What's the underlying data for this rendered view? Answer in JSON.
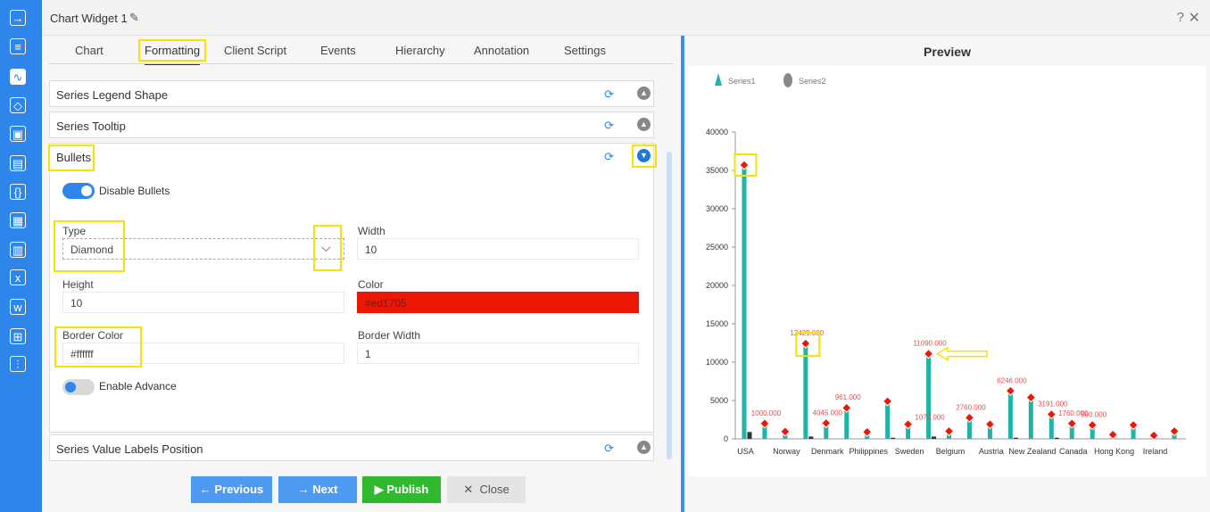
{
  "window": {
    "title": "Chart Widget 1",
    "help": "?",
    "close": "✕"
  },
  "rail": {
    "icons": [
      "sign-in-icon",
      "table-icon",
      "chart-icon",
      "cubes-icon",
      "doc-icon",
      "id-card-icon",
      "braces-icon",
      "image-icon",
      "layout-icon",
      "excel-icon",
      "word-icon",
      "hierarchy-icon",
      "stats-icon"
    ]
  },
  "tabs": [
    "Chart",
    "Formatting",
    "Client Script",
    "Events",
    "Hierarchy",
    "Annotation",
    "Settings"
  ],
  "sections": {
    "legend_shape": "Series Legend Shape",
    "tooltip": "Series Tooltip",
    "bullets": "Bullets",
    "value_labels": "Series Value Labels Position"
  },
  "bullets": {
    "disable_label": "Disable Bullets",
    "type_label": "Type",
    "type_value": "Diamond",
    "width_label": "Width",
    "width_value": "10",
    "height_label": "Height",
    "height_value": "10",
    "color_label": "Color",
    "color_value": "#ed1705",
    "border_color_label": "Border Color",
    "border_color_value": "#ffffff",
    "border_width_label": "Border Width",
    "border_width_value": "1",
    "advance_label": "Enable Advance"
  },
  "buttons": {
    "previous": "Previous",
    "next": "Next",
    "publish": "Publish",
    "close": "Close"
  },
  "preview": {
    "title": "Preview"
  },
  "chart_data": {
    "type": "bar",
    "categories": [
      "USA",
      "",
      "Norway",
      "",
      "Denmark",
      "",
      "Philippines",
      "",
      "Sweden",
      "",
      "Belgium",
      "",
      "Austria",
      "",
      "New Zealand",
      "",
      "Canada",
      "",
      "Hong Kong",
      "",
      "Ireland",
      ""
    ],
    "series": [
      {
        "name": "Series1",
        "values": [
          35700,
          2000,
          950,
          12429,
          2050,
          4045,
          900,
          4900,
          1900,
          11090,
          1000,
          2760,
          1900,
          6246,
          5400,
          3200,
          2000,
          1800,
          550,
          1800,
          450,
          1000
        ]
      },
      {
        "name": "Series2",
        "values": [
          900,
          0,
          0,
          300,
          0,
          0,
          0,
          150,
          0,
          300,
          0,
          0,
          0,
          150,
          0,
          150,
          0,
          0,
          0,
          0,
          0,
          0
        ]
      }
    ],
    "data_labels": [
      {
        "index": 1,
        "text": "1000.000"
      },
      {
        "index": 3,
        "text": "12429.000"
      },
      {
        "index": 4,
        "text": "4045.000"
      },
      {
        "index": 5,
        "text": "961.000"
      },
      {
        "index": 9,
        "text": "11090.000"
      },
      {
        "index": 9,
        "text": "1070.000"
      },
      {
        "index": 11,
        "text": "2760.000"
      },
      {
        "index": 13,
        "text": "6246.000"
      },
      {
        "index": 15,
        "text": "3191.000"
      },
      {
        "index": 16,
        "text": "1760.000"
      },
      {
        "index": 17,
        "text": "590.000"
      }
    ],
    "ylim": [
      0,
      40000
    ],
    "yticks": [
      0,
      5000,
      10000,
      15000,
      20000,
      25000,
      30000,
      35000,
      40000
    ],
    "legend": "top-left",
    "colors": {
      "series1": "#20b3a8",
      "series2": "#333333",
      "bullet": "#ed1705",
      "label": "#e05050"
    }
  }
}
